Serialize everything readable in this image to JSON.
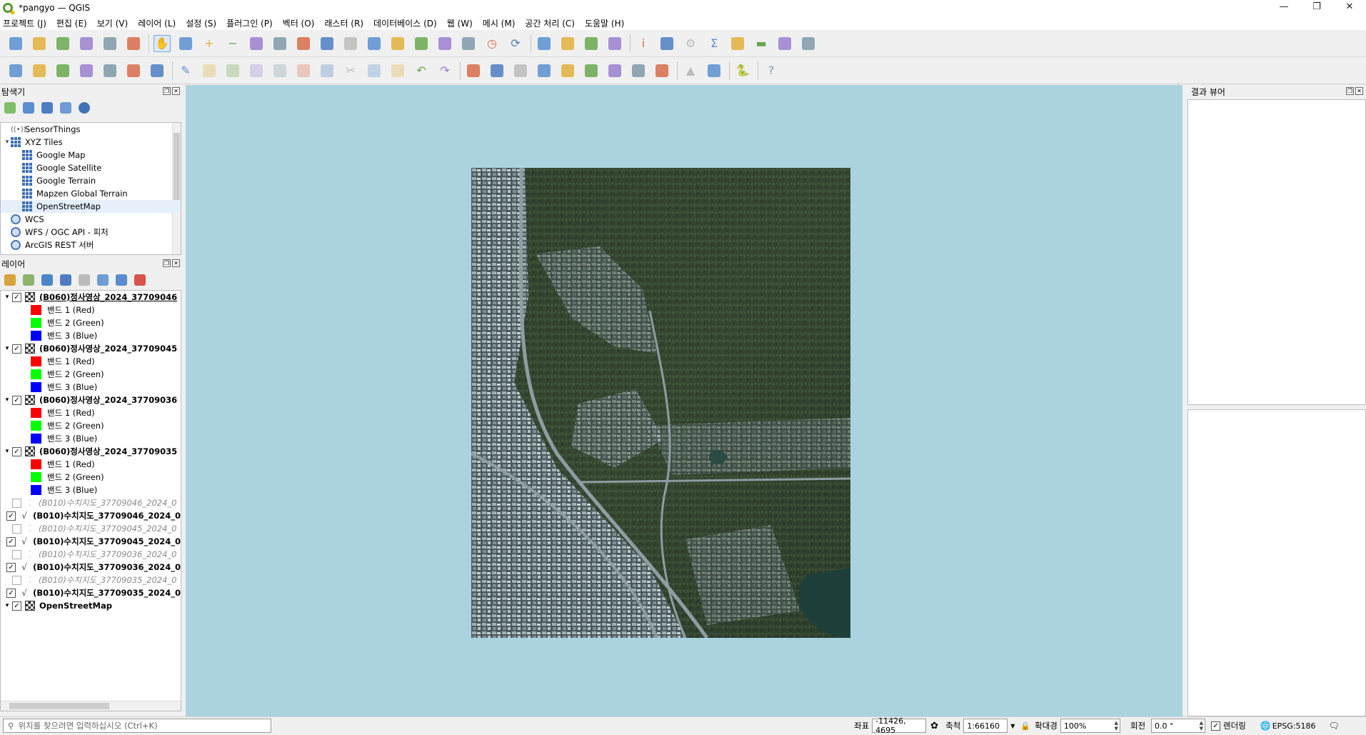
{
  "window": {
    "title": "*pangyo — QGIS",
    "minimize": "—",
    "maximize": "❐",
    "close": "✕"
  },
  "menu": [
    "프로젝트 (J)",
    "편집 (E)",
    "보기 (V)",
    "레이어 (L)",
    "설정 (S)",
    "플러그인 (P)",
    "벡터 (O)",
    "래스터 (R)",
    "데이터베이스 (D)",
    "웹 (W)",
    "메시 (M)",
    "공간 처리 (C)",
    "도움말 (H)"
  ],
  "browser": {
    "title": "탐색기",
    "items": [
      {
        "label": "SensorThings",
        "indent": 0,
        "icon": "sensor-icon",
        "arrow": ""
      },
      {
        "label": "XYZ Tiles",
        "indent": 0,
        "icon": "xyz-tiles-icon",
        "arrow": "▾"
      },
      {
        "label": "Google Map",
        "indent": 1,
        "icon": "xyz-tiles-icon",
        "arrow": ""
      },
      {
        "label": "Google Satellite",
        "indent": 1,
        "icon": "xyz-tiles-icon",
        "arrow": ""
      },
      {
        "label": "Google Terrain",
        "indent": 1,
        "icon": "xyz-tiles-icon",
        "arrow": ""
      },
      {
        "label": "Mapzen Global Terrain",
        "indent": 1,
        "icon": "xyz-tiles-icon",
        "arrow": ""
      },
      {
        "label": "OpenStreetMap",
        "indent": 1,
        "icon": "xyz-tiles-icon",
        "arrow": "",
        "selected": true
      },
      {
        "label": "WCS",
        "indent": 0,
        "icon": "globe-icon",
        "arrow": ""
      },
      {
        "label": "WFS / OGC API - 피처",
        "indent": 0,
        "icon": "globe-icon",
        "arrow": ""
      },
      {
        "label": "ArcGIS REST 서버",
        "indent": 0,
        "icon": "globe-icon",
        "arrow": ""
      }
    ]
  },
  "layers": {
    "title": "레이어",
    "colors": {
      "red": "#ff0000",
      "green": "#00ff00",
      "blue": "#0000ff"
    },
    "items": [
      {
        "type": "raster",
        "label": "(B060)정사영상_2024_37709046",
        "checked": true,
        "underline": true
      },
      {
        "type": "band",
        "label": "밴드 1 (Red)",
        "color": "#ff0000"
      },
      {
        "type": "band",
        "label": "밴드 2 (Green)",
        "color": "#00ff00"
      },
      {
        "type": "band",
        "label": "밴드 3 (Blue)",
        "color": "#0000ff"
      },
      {
        "type": "raster",
        "label": "(B060)정사영상_2024_37709045",
        "checked": true
      },
      {
        "type": "band",
        "label": "밴드 1 (Red)",
        "color": "#ff0000"
      },
      {
        "type": "band",
        "label": "밴드 2 (Green)",
        "color": "#00ff00"
      },
      {
        "type": "band",
        "label": "밴드 3 (Blue)",
        "color": "#0000ff"
      },
      {
        "type": "raster",
        "label": "(B060)정사영상_2024_37709036",
        "checked": true
      },
      {
        "type": "band",
        "label": "밴드 1 (Red)",
        "color": "#ff0000"
      },
      {
        "type": "band",
        "label": "밴드 2 (Green)",
        "color": "#00ff00"
      },
      {
        "type": "band",
        "label": "밴드 3 (Blue)",
        "color": "#0000ff"
      },
      {
        "type": "raster",
        "label": "(B060)정사영상_2024_37709035",
        "checked": true
      },
      {
        "type": "band",
        "label": "밴드 1 (Red)",
        "color": "#ff0000"
      },
      {
        "type": "band",
        "label": "밴드 2 (Green)",
        "color": "#00ff00"
      },
      {
        "type": "band",
        "label": "밴드 3 (Blue)",
        "color": "#0000ff"
      },
      {
        "type": "points",
        "label": "(B010)수치지도_37709046_2024_0",
        "checked": false
      },
      {
        "type": "lines",
        "label": "(B010)수치지도_37709046_2024_0",
        "checked": true
      },
      {
        "type": "points",
        "label": "(B010)수치지도_37709045_2024_0",
        "checked": false
      },
      {
        "type": "lines",
        "label": "(B010)수치지도_37709045_2024_0",
        "checked": true
      },
      {
        "type": "points",
        "label": "(B010)수치지도_37709036_2024_0",
        "checked": false
      },
      {
        "type": "lines",
        "label": "(B010)수치지도_37709036_2024_0",
        "checked": true
      },
      {
        "type": "points",
        "label": "(B010)수치지도_37709035_2024_0",
        "checked": false
      },
      {
        "type": "lines",
        "label": "(B010)수치지도_37709035_2024_0",
        "checked": true
      },
      {
        "type": "raster",
        "label": "OpenStreetMap",
        "checked": true
      }
    ]
  },
  "results": {
    "title": "결과 뷰어"
  },
  "canvas": {
    "background": "#aad3df"
  },
  "status": {
    "locator_placeholder": "위치를 찾으려면 입력하십시오 (Ctrl+K)",
    "coord_label": "좌표",
    "coord_value": "-11426, 4695",
    "scale_label": "축척",
    "scale_value": "1:66160",
    "magnifier_label": "확대경",
    "magnifier_value": "100%",
    "rotation_label": "회전",
    "rotation_value": "0.0 °",
    "render_label": "렌더링",
    "crs": "EPSG:5186"
  },
  "icons": {
    "toolbar1": [
      "new-project-icon",
      "open-project-icon",
      "save-project-icon",
      "save-as-icon",
      "print-layout-icon",
      "style-manager-icon",
      "sep",
      "pan-icon",
      "pan-to-selection-icon",
      "zoom-in-icon",
      "zoom-out-icon",
      "zoom-full-icon",
      "zoom-selection-icon",
      "zoom-layer-icon",
      "zoom-native-icon",
      "zoom-last-icon",
      "zoom-next-icon",
      "new-map-view-icon",
      "new-3d-view-icon",
      "bookmark-new-icon",
      "bookmarks-icon",
      "temporal-icon",
      "refresh-icon",
      "sep",
      "select-feature-icon",
      "select-value-icon",
      "deselect-icon",
      "select-location-icon",
      "sep",
      "identify-icon",
      "attribute-table-icon",
      "settings-gear-icon",
      "statistics-sigma-icon",
      "field-calc-icon",
      "measure-icon",
      "map-tips-icon",
      "annotation-icon"
    ],
    "toolbar2": [
      "data-source-icon",
      "geopackage-icon",
      "new-shapefile-icon",
      "new-temp-layer-icon",
      "virtual-layer-icon",
      "raster-calc-icon",
      "spatialite-icon",
      "sep",
      "edit-pencil-icon",
      "toggle-editing-icon",
      "save-edits-icon",
      "digitize-icon",
      "vertex-tool-icon",
      "node-tool-icon",
      "delete-icon",
      "cut-icon",
      "copy-icon",
      "paste-icon",
      "undo-icon",
      "redo-icon",
      "sep",
      "label-icon",
      "label-pin-icon",
      "label-abc-icon",
      "label-abc-red-icon",
      "label-move-icon",
      "label-rotate-icon",
      "label-change-icon",
      "label-show-icon",
      "label-diagram-icon",
      "sep",
      "grass-triangle-icon",
      "globe-plugin-icon",
      "sep",
      "python-icon",
      "sep",
      "help-icon"
    ]
  }
}
